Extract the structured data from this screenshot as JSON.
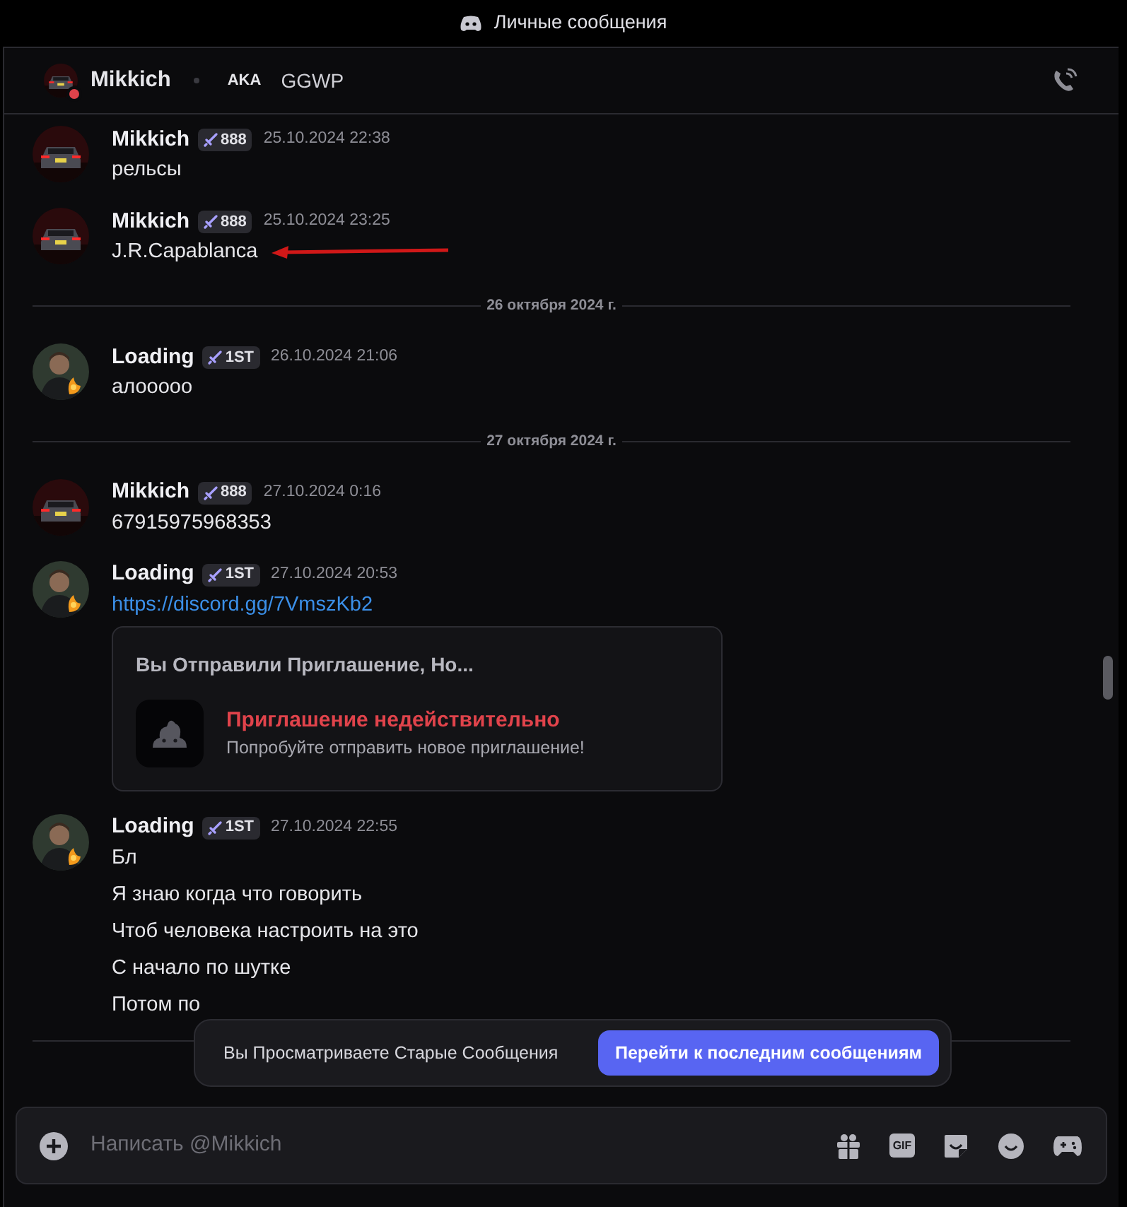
{
  "window": {
    "title": "Личные сообщения"
  },
  "header": {
    "name": "Mikkich",
    "do_not_disturb": true,
    "aka_label": "AKA",
    "aka": "GGWP"
  },
  "feed": [
    {
      "kind": "message",
      "author": "Mikkich",
      "badge": "888",
      "time": "25.10.2024 22:38",
      "lines": [
        "рельсы"
      ]
    },
    {
      "kind": "message",
      "author": "Mikkich",
      "badge": "888",
      "time": "25.10.2024 23:25",
      "lines": [
        "J.R.Capablanca"
      ],
      "arrow": true
    },
    {
      "kind": "divider",
      "label": "26 октября 2024 г."
    },
    {
      "kind": "message",
      "author": "Loading",
      "badge": "1ST",
      "time": "26.10.2024 21:06",
      "lines": [
        "алооооо"
      ]
    },
    {
      "kind": "divider",
      "label": "27 октября 2024 г."
    },
    {
      "kind": "message",
      "author": "Mikkich",
      "badge": "888",
      "time": "27.10.2024 0:16",
      "lines": [
        "67915975968353"
      ]
    },
    {
      "kind": "message",
      "author": "Loading",
      "badge": "1ST",
      "time": "27.10.2024 20:53",
      "link": "https://discord.gg/7VmszKb2",
      "embed": {
        "title": "Вы Отправили Приглашение, Но...",
        "error": "Приглашение недействительно",
        "hint": "Попробуйте отправить новое приглашение!"
      }
    },
    {
      "kind": "message",
      "author": "Loading",
      "badge": "1ST",
      "time": "27.10.2024 22:55",
      "lines": [
        "Бл",
        "Я знаю когда что говорить",
        "Чтоб человека настроить на это",
        "С начало по шутке",
        "Потом по"
      ]
    }
  ],
  "toast": {
    "text": "Вы Просматриваете Старые Сообщения",
    "button": "Перейти к последним сообщениям"
  },
  "composer": {
    "placeholder": "Написать @Mikkich",
    "gif": "GIF"
  }
}
